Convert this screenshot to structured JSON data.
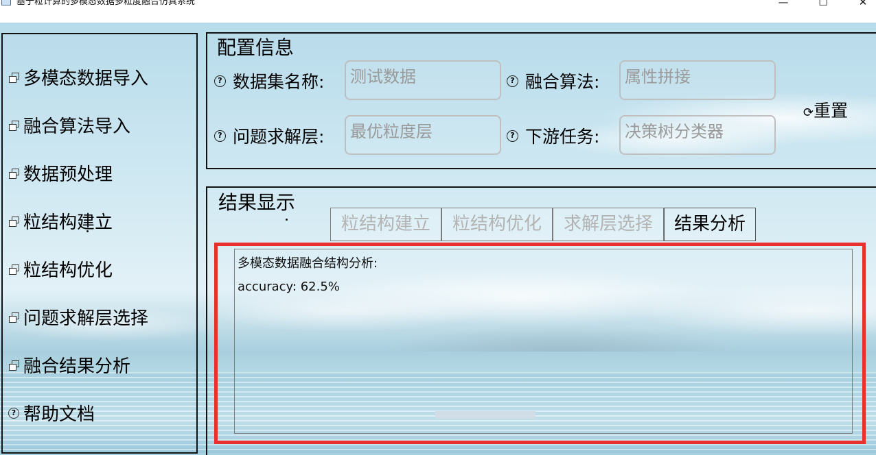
{
  "window": {
    "title": "基于粒计算的多模态数据多粒度融合仿真系统",
    "controls": {
      "minimize": "—",
      "maximize": "☐",
      "close": "✕"
    }
  },
  "sidebar": {
    "items": [
      {
        "label": "多模态数据导入",
        "icon": "window-icon"
      },
      {
        "label": "融合算法导入",
        "icon": "window-icon"
      },
      {
        "label": "数据预处理",
        "icon": "window-icon"
      },
      {
        "label": "粒结构建立",
        "icon": "window-icon"
      },
      {
        "label": "粒结构优化",
        "icon": "window-icon"
      },
      {
        "label": "问题求解层选择",
        "icon": "window-icon"
      },
      {
        "label": "融合结果分析",
        "icon": "window-icon"
      },
      {
        "label": "帮助文档",
        "icon": "help-icon"
      }
    ]
  },
  "config": {
    "title": "配置信息",
    "dataset": {
      "label": "数据集名称:",
      "value": "测试数据"
    },
    "algorithm": {
      "label": "融合算法:",
      "value": "属性拼接"
    },
    "solve_layer": {
      "label": "问题求解层:",
      "value": "最优粒度层"
    },
    "task": {
      "label": "下游任务:",
      "value": "决策树分类器"
    },
    "reset_label": "重置",
    "help_icon": "?"
  },
  "result": {
    "title": "结果显示",
    "tabs": [
      {
        "label": "粒结构建立",
        "active": false
      },
      {
        "label": "粒结构优化",
        "active": false
      },
      {
        "label": "求解层选择",
        "active": false
      },
      {
        "label": "结果分析",
        "active": true
      }
    ],
    "lines": [
      "多模态数据融合结构分析:",
      "accuracy: 62.5%"
    ]
  },
  "colors": {
    "highlight": "#e8302f",
    "disabled_text": "#b3b3b3",
    "field_text": "#9a9a9a"
  }
}
